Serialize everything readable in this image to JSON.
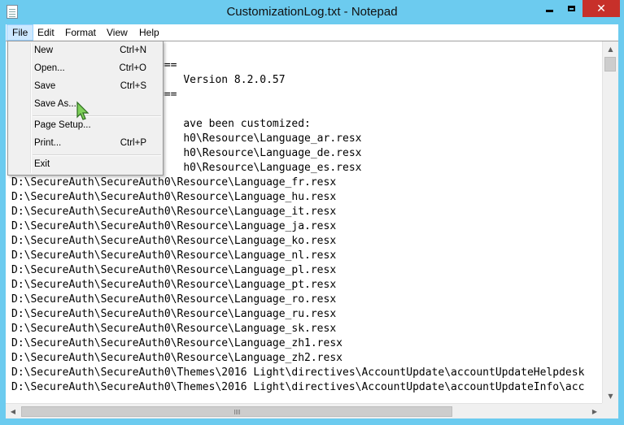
{
  "window": {
    "title": "CustomizationLog.txt - Notepad"
  },
  "menubar": {
    "items": [
      "File",
      "Edit",
      "Format",
      "View",
      "Help"
    ],
    "active": "File"
  },
  "file_menu": {
    "items": [
      {
        "label": "New",
        "shortcut": "Ctrl+N"
      },
      {
        "label": "Open...",
        "shortcut": "Ctrl+O"
      },
      {
        "label": "Save",
        "shortcut": "Ctrl+S"
      },
      {
        "label": "Save As...",
        "shortcut": ""
      },
      {
        "label": "Page Setup...",
        "shortcut": ""
      },
      {
        "label": "Print...",
        "shortcut": "Ctrl+P"
      },
      {
        "label": "Exit",
        "shortcut": ""
      }
    ]
  },
  "document": {
    "lines": [
      "",
      "==========================",
      "                           Version 8.2.0.57",
      "==========================",
      "",
      "                           ave been customized:",
      "                           h0\\Resource\\Language_ar.resx",
      "                           h0\\Resource\\Language_de.resx",
      "                           h0\\Resource\\Language_es.resx",
      "D:\\SecureAuth\\SecureAuth0\\Resource\\Language_fr.resx",
      "D:\\SecureAuth\\SecureAuth0\\Resource\\Language_hu.resx",
      "D:\\SecureAuth\\SecureAuth0\\Resource\\Language_it.resx",
      "D:\\SecureAuth\\SecureAuth0\\Resource\\Language_ja.resx",
      "D:\\SecureAuth\\SecureAuth0\\Resource\\Language_ko.resx",
      "D:\\SecureAuth\\SecureAuth0\\Resource\\Language_nl.resx",
      "D:\\SecureAuth\\SecureAuth0\\Resource\\Language_pl.resx",
      "D:\\SecureAuth\\SecureAuth0\\Resource\\Language_pt.resx",
      "D:\\SecureAuth\\SecureAuth0\\Resource\\Language_ro.resx",
      "D:\\SecureAuth\\SecureAuth0\\Resource\\Language_ru.resx",
      "D:\\SecureAuth\\SecureAuth0\\Resource\\Language_sk.resx",
      "D:\\SecureAuth\\SecureAuth0\\Resource\\Language_zh1.resx",
      "D:\\SecureAuth\\SecureAuth0\\Resource\\Language_zh2.resx",
      "D:\\SecureAuth\\SecureAuth0\\Themes\\2016 Light\\directives\\AccountUpdate\\accountUpdateHelpdesk",
      "D:\\SecureAuth\\SecureAuth0\\Themes\\2016 Light\\directives\\AccountUpdate\\accountUpdateInfo\\acc"
    ]
  },
  "icons": {
    "app": "notepad-icon",
    "minimize": "minimize-icon",
    "maximize": "maximize-icon",
    "close": "close-icon",
    "cursor": "mouse-pointer-icon"
  },
  "colors": {
    "titlebar": "#6ccbef",
    "close": "#c7302a",
    "menu_highlight": "#cce8ff"
  }
}
